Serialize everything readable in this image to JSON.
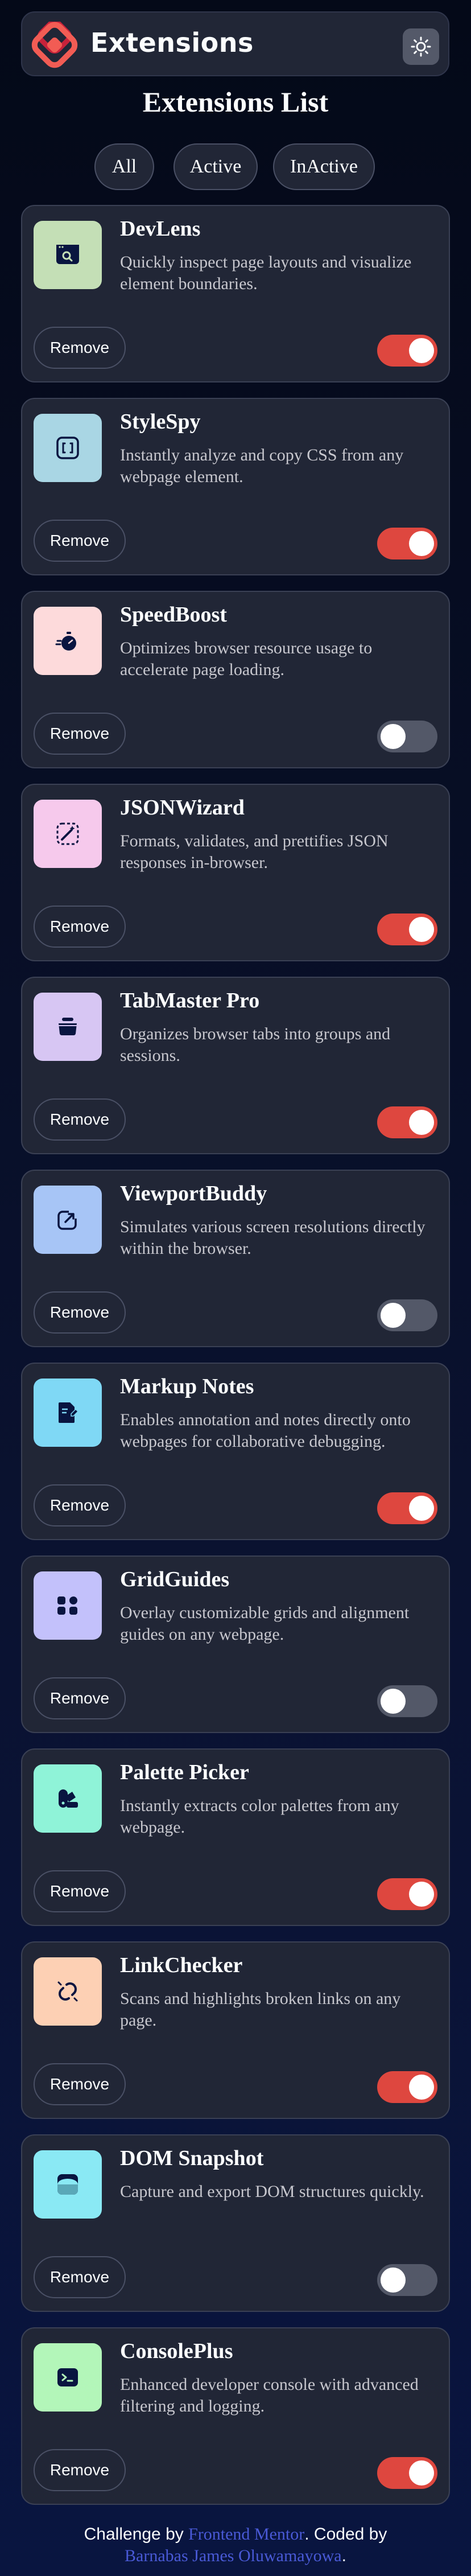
{
  "header": {
    "title": "Extensions",
    "theme_icon": "sun-icon"
  },
  "page_title": "Extensions List",
  "filters": [
    {
      "label": "All"
    },
    {
      "label": "Active"
    },
    {
      "label": "InActive"
    }
  ],
  "remove_label": "Remove",
  "extensions": [
    {
      "name": "DevLens",
      "description": "Quickly inspect page layouts and visualize element boundaries.",
      "icon": "search-window-icon",
      "icon_bg": "#c4dfb6",
      "active": true
    },
    {
      "name": "StyleSpy",
      "description": "Instantly analyze and copy CSS from any webpage element.",
      "icon": "code-brackets-icon",
      "icon_bg": "#a9d6e4",
      "active": true
    },
    {
      "name": "SpeedBoost",
      "description": "Optimizes browser resource usage to accelerate page loading.",
      "icon": "stopwatch-icon",
      "icon_bg": "#fddadb",
      "active": false
    },
    {
      "name": "JSONWizard",
      "description": "Formats, validates, and prettifies JSON responses in-browser.",
      "icon": "magic-wand-icon",
      "icon_bg": "#f6c9ec",
      "active": true
    },
    {
      "name": "TabMaster Pro",
      "description": "Organizes browser tabs into groups and sessions.",
      "icon": "tab-stack-icon",
      "icon_bg": "#d7c6f3",
      "active": true
    },
    {
      "name": "ViewportBuddy",
      "description": "Simulates various screen resolutions directly within the browser.",
      "icon": "resize-icon",
      "icon_bg": "#a7c5f6",
      "active": false
    },
    {
      "name": "Markup Notes",
      "description": "Enables annotation and notes directly onto webpages for collaborative debugging.",
      "icon": "note-pen-icon",
      "icon_bg": "#7fd8f5",
      "active": true
    },
    {
      "name": "GridGuides",
      "description": "Overlay customizable grids and alignment guides on any webpage.",
      "icon": "grid-icon",
      "icon_bg": "#c3c1fb",
      "active": false
    },
    {
      "name": "Palette Picker",
      "description": "Instantly extracts color palettes from any webpage.",
      "icon": "palette-icon",
      "icon_bg": "#8ff3d8",
      "active": true
    },
    {
      "name": "LinkChecker",
      "description": "Scans and highlights broken links on any page.",
      "icon": "broken-link-icon",
      "icon_bg": "#fdd0b4",
      "active": true
    },
    {
      "name": "DOM Snapshot",
      "description": "Capture and export DOM structures quickly.",
      "icon": "camera-box-icon",
      "icon_bg": "#8ae9f4",
      "active": false
    },
    {
      "name": "ConsolePlus",
      "description": "Enhanced developer console with advanced filtering and logging.",
      "icon": "terminal-icon",
      "icon_bg": "#b3f6b9",
      "active": true
    }
  ],
  "footer": {
    "prefix": "Challenge by ",
    "link1": "Frontend Mentor",
    "middle": ". Coded by ",
    "link2": "Barnabas James Oluwamayowa",
    "suffix": "."
  }
}
